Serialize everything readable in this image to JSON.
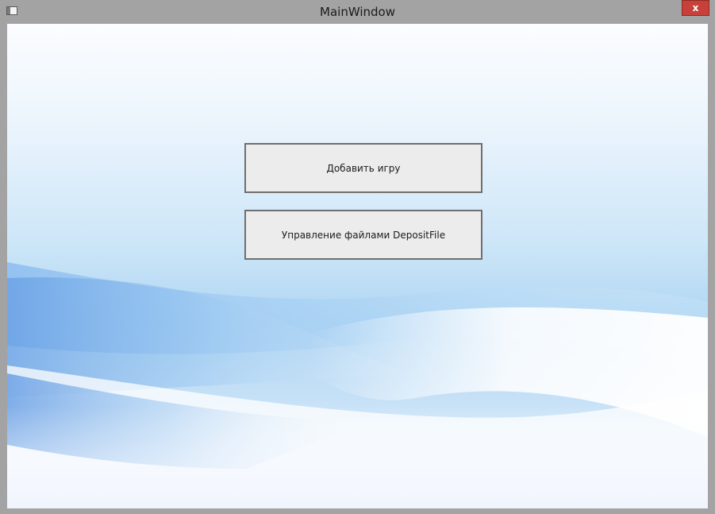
{
  "window": {
    "title": "MainWindow",
    "close_symbol": "x"
  },
  "icons": {
    "app": "window-app-icon",
    "close": "close-icon"
  },
  "buttons": {
    "add_game": "Добавить игру",
    "manage_files": "Управление файлами DepositFile"
  },
  "colors": {
    "frame": "#a3a3a3",
    "close": "#c7413a",
    "button_face": "#ececec",
    "button_border": "#6f6f6f",
    "background_sky": "#aed5f3",
    "background_deep": "#6ea6e6"
  }
}
